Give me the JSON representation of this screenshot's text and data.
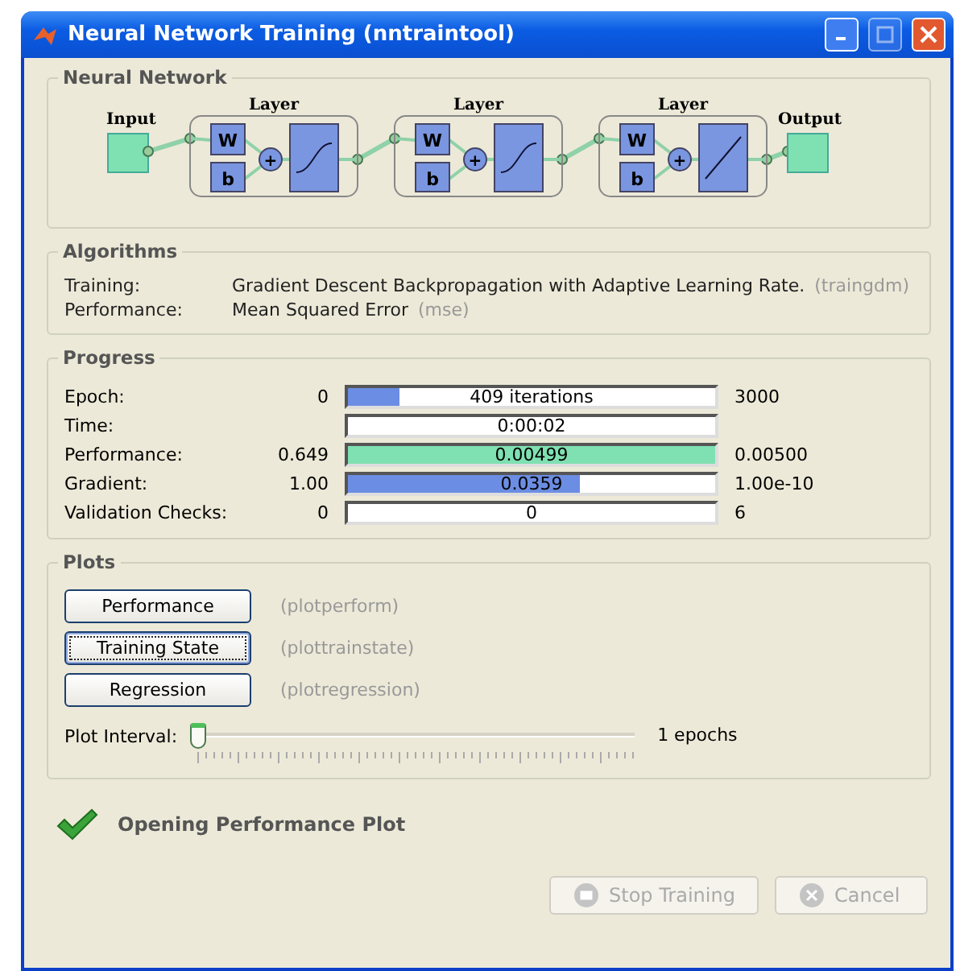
{
  "window": {
    "title": "Neural Network Training (nntraintool)"
  },
  "neural_network": {
    "title": "Neural Network",
    "input": "Input",
    "output": "Output",
    "layers": [
      {
        "label": "Layer",
        "weight": "W",
        "bias": "b",
        "sum": "+",
        "kind": "sigmoid"
      },
      {
        "label": "Layer",
        "weight": "W",
        "bias": "b",
        "sum": "+",
        "kind": "sigmoid"
      },
      {
        "label": "Layer",
        "weight": "W",
        "bias": "b",
        "sum": "+",
        "kind": "linear"
      }
    ]
  },
  "algorithms": {
    "title": "Algorithms",
    "rows": [
      {
        "label": "Training:",
        "value": "Gradient Descent Backpropagation with Adaptive Learning Rate.",
        "function": "(traingdm)"
      },
      {
        "label": "Performance:",
        "value": "Mean Squared Error",
        "function": "(mse)"
      }
    ]
  },
  "progress": {
    "title": "Progress",
    "rows": [
      {
        "label": "Epoch:",
        "start": "0",
        "reading": "409 iterations",
        "end": "3000",
        "level": 0.14,
        "color": "#6b8de3"
      },
      {
        "label": "Time:",
        "reading": "0:00:02"
      },
      {
        "label": "Performance:",
        "start": "0.649",
        "reading": "0.00499",
        "end": "0.00500",
        "level": 1,
        "color": "#7fe0b2"
      },
      {
        "label": "Gradient:",
        "start": "1.00",
        "reading": "0.0359",
        "end": "1.00e-10",
        "level": 0.63,
        "color": "#6b8de3"
      },
      {
        "label": "Validation Checks:",
        "start": "0",
        "reading": "0",
        "end": "6"
      }
    ]
  },
  "plots": {
    "title": "Plots",
    "buttons": [
      {
        "label": "Performance",
        "function": "(plotperform)",
        "focused": false
      },
      {
        "label": "Training State",
        "function": "(plottrainstate)",
        "focused": true
      },
      {
        "label": "Regression",
        "function": "(plotregression)",
        "focused": false
      }
    ],
    "interval": {
      "label": "Plot Interval:",
      "level": 0,
      "reading": "1 epochs"
    }
  },
  "status": {
    "message": "Opening Performance Plot"
  },
  "buttons": [
    {
      "label": "Stop Training",
      "disabled": true
    },
    {
      "label": "Cancel",
      "disabled": true
    }
  ]
}
